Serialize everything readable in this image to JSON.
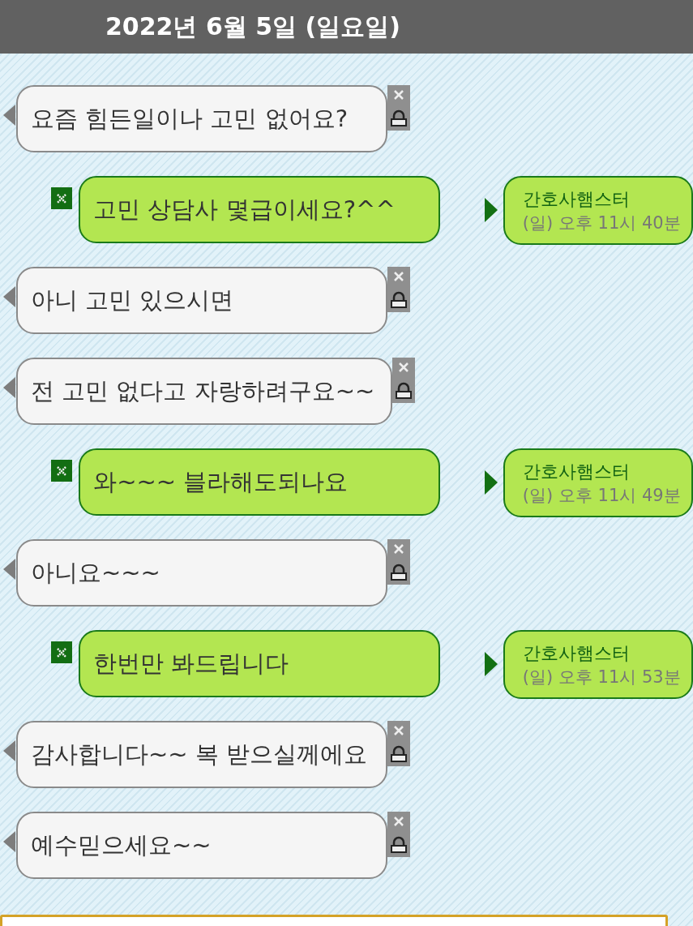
{
  "header": {
    "title": "2022년 6월 5일 (일요일)"
  },
  "messages": [
    {
      "kind": "in",
      "text": "요즘 힘든일이나 고민 없어요?"
    },
    {
      "kind": "out",
      "text": "고민 상담사 몇급이세요?^^",
      "sender": "간호사햄스터",
      "time": "(일) 오후 11시 40분"
    },
    {
      "kind": "in",
      "text": "아니 고민 있으시면"
    },
    {
      "kind": "in",
      "text": "전 고민 없다고 자랑하려구요~~"
    },
    {
      "kind": "out",
      "text": "와~~~ 블라해도되나요",
      "sender": "간호사햄스터",
      "time": "(일) 오후 11시 49분"
    },
    {
      "kind": "in",
      "text": "아니요~~~"
    },
    {
      "kind": "out",
      "text": "한번만 봐드립니다",
      "sender": "간호사햄스터",
      "time": "(일) 오후 11시 53분"
    },
    {
      "kind": "in",
      "text": "감사합니다~~ 복 받으실께에요"
    },
    {
      "kind": "in",
      "text": "예수믿으세요~~"
    }
  ]
}
